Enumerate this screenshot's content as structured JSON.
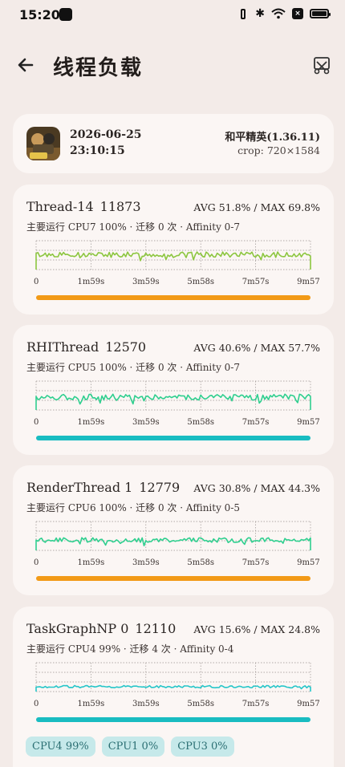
{
  "status_bar": {
    "time": "15:20"
  },
  "header": {
    "title": "线程负载"
  },
  "session": {
    "date": "2026-06-25",
    "time": "23:10:15",
    "game": "和平精英(1.36.11)",
    "crop": "crop: 720×1584"
  },
  "threads": [
    {
      "name": "Thread-14",
      "tid": "11873",
      "stats": "AVG 51.8% / MAX 69.8%",
      "sub": "主要运行 CPU7 100% · 迁移 0 次 · Affinity 0-7",
      "color": "#8cc63f",
      "bar": "#f29a17",
      "level": 0.518,
      "jitter": 0.09
    },
    {
      "name": "RHIThread",
      "tid": "12570",
      "stats": "AVG 40.6% / MAX 57.7%",
      "sub": "主要运行 CPU5 100% · 迁移 0 次 · Affinity 0-7",
      "color": "#2fcf8f",
      "bar": "#19bcc1",
      "level": 0.45,
      "jitter": 0.1
    },
    {
      "name": "RenderThread 1",
      "tid": "12779",
      "stats": "AVG 30.8% / MAX 44.3%",
      "sub": "主要运行 CPU6 100% · 迁移 0 次 · Affinity 0-5",
      "color": "#2fcf8f",
      "bar": "#f29a17",
      "level": 0.36,
      "jitter": 0.08
    },
    {
      "name": "TaskGraphNP 0",
      "tid": "12110",
      "stats": "AVG 15.6% / MAX 24.8%",
      "sub": "主要运行 CPU4 99% · 迁移 4 次 · Affinity 0-4",
      "color": "#26c6c9",
      "bar": "#19bcc1",
      "level": 0.17,
      "jitter": 0.04
    }
  ],
  "x_ticks": [
    "0",
    "1m59s",
    "3m59s",
    "5m58s",
    "7m57s",
    "9m57s"
  ],
  "cpu_chips": [
    "CPU4 99%",
    "CPU1 0%",
    "CPU3 0%"
  ]
}
